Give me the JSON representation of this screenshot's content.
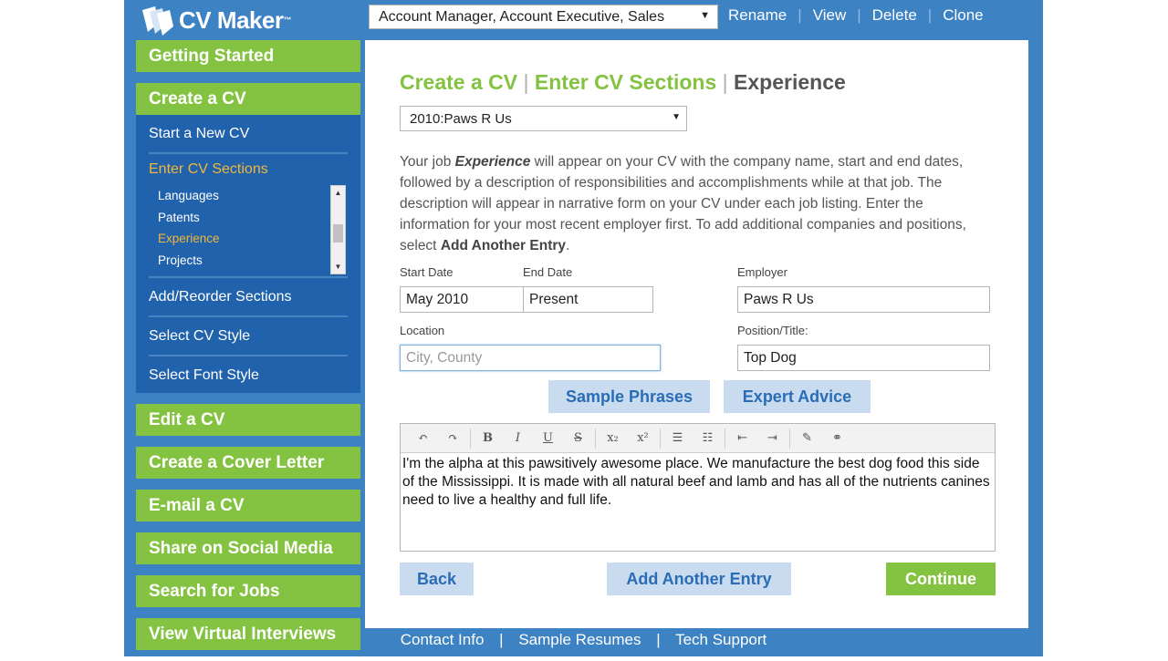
{
  "header": {
    "logo_text": "CV Maker",
    "logo_tm": "™",
    "cv_select_value": "Account Manager, Account Executive, Sales",
    "actions": [
      "Rename",
      "View",
      "Delete",
      "Clone"
    ]
  },
  "sidebar": {
    "getting_started": "Getting Started",
    "create_cv": "Create a CV",
    "submenu": {
      "start_new": "Start a New CV",
      "enter_sections": "Enter CV Sections",
      "sections": [
        "Languages",
        "Patents",
        "Experience",
        "Projects"
      ],
      "selected_section": "Experience",
      "add_reorder": "Add/Reorder Sections",
      "select_style": "Select CV Style",
      "select_font": "Select Font Style"
    },
    "bottom_items": [
      "Edit a CV",
      "Create a Cover Letter",
      "E-mail a CV",
      "Share on Social Media",
      "Search for Jobs",
      "View Virtual Interviews"
    ]
  },
  "main": {
    "crumb1": "Create a CV",
    "crumb2": "Enter CV Sections",
    "crumb3": "Experience",
    "crumb_sep": "|",
    "entry_select": "2010:Paws R Us",
    "desc_1": "Your job ",
    "desc_bold1": "Experience",
    "desc_2": " will appear on your CV with the company name, start and end dates, followed by a description of responsibilities and accomplishments while at that job. The description will appear in narrative form on your CV under each job listing. Enter the information for your most recent employer first. To add additional companies and positions, select ",
    "desc_bold2": "Add Another Entry",
    "desc_3": ".",
    "labels": {
      "start_date": "Start Date",
      "end_date": "End Date",
      "employer": "Employer",
      "location": "Location",
      "position": "Position/Title:"
    },
    "values": {
      "start_date": "May 2010",
      "end_date": "Present",
      "employer": "Paws R Us",
      "location_placeholder": "City, County",
      "position": "Top Dog"
    },
    "sample_phrases": "Sample Phrases",
    "expert_advice": "Expert Advice",
    "editor_text": "I'm the alpha at this pawsitively awesome place. We manufacture the best dog food this side of the Mississippi. It is made with all natural beef and lamb and has all of the nutrients canines need to live a healthy and full life.",
    "toolbar_icons": [
      "undo-icon",
      "redo-icon",
      "bold-icon",
      "italic-icon",
      "underline-icon",
      "strikethrough-icon",
      "subscript-icon",
      "superscript-icon",
      "numbered-list-icon",
      "bullet-list-icon",
      "outdent-icon",
      "indent-icon",
      "paste-icon",
      "unlink-icon"
    ],
    "back": "Back",
    "add_another": "Add Another Entry",
    "continue": "Continue"
  },
  "footer": {
    "links": [
      "Contact Info",
      "Sample Resumes",
      "Tech Support"
    ],
    "sep": "|"
  },
  "colors": {
    "frame_blue": "#3d82c3",
    "submenu_blue": "#2162ac",
    "green": "#84c341",
    "orange_active": "#f0b73a",
    "light_button": "#c9dcef",
    "button_text_blue": "#2a6cb5"
  }
}
